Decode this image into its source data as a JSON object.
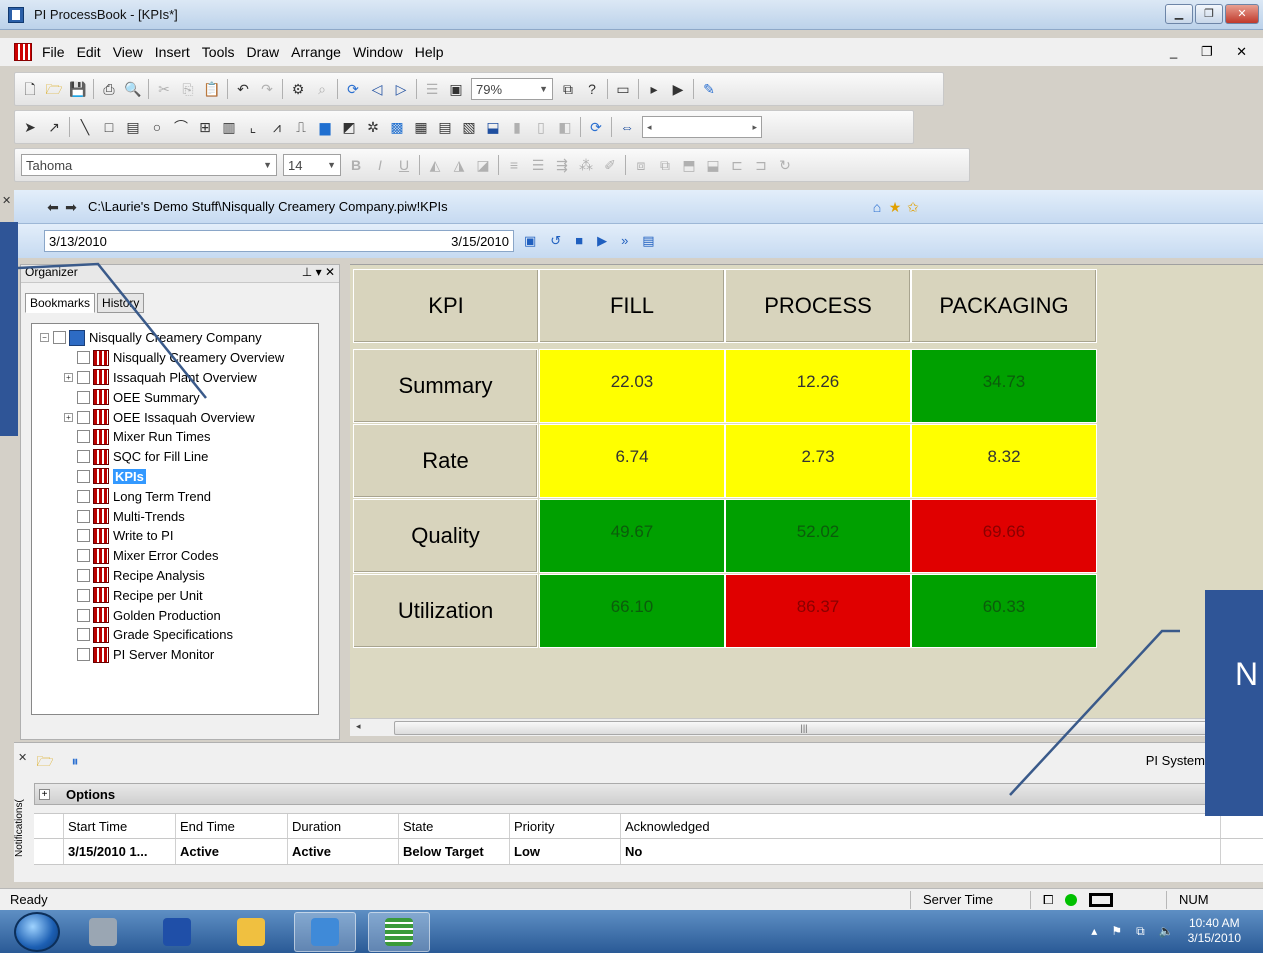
{
  "window": {
    "title": "PI ProcessBook - [KPIs*]",
    "buttons": [
      "▁",
      "❐",
      "✕"
    ]
  },
  "menu": {
    "items": [
      "File",
      "Edit",
      "View",
      "Insert",
      "Tools",
      "Draw",
      "Arrange",
      "Window",
      "Help"
    ],
    "right_controls": "_ ❐ ✕"
  },
  "toolbar": {
    "zoom_value": "79%",
    "font_name": "Tahoma",
    "font_size": "14"
  },
  "navigation": {
    "path": "C:\\Laurie's Demo Stuff\\Nisqually Creamery Company.piw!KPIs",
    "start_time": "3/13/2010",
    "end_time": "3/15/2010"
  },
  "organizer": {
    "title": "Organizer",
    "tabs": [
      "Bookmarks",
      "History"
    ],
    "root": "Nisqually Creamery Company",
    "items": [
      {
        "label": "Nisqually Creamery Overview",
        "expandable": false,
        "selected": false
      },
      {
        "label": "Issaquah Plant Overview",
        "expandable": true,
        "selected": false
      },
      {
        "label": "OEE Summary",
        "expandable": false,
        "selected": false
      },
      {
        "label": "OEE Issaquah Overview",
        "expandable": true,
        "selected": false
      },
      {
        "label": "Mixer Run Times",
        "expandable": false,
        "selected": false
      },
      {
        "label": "SQC for Fill Line",
        "expandable": false,
        "selected": false
      },
      {
        "label": "KPIs",
        "expandable": false,
        "selected": true
      },
      {
        "label": "Long Term Trend",
        "expandable": false,
        "selected": false
      },
      {
        "label": "Multi-Trends",
        "expandable": false,
        "selected": false
      },
      {
        "label": "Write to PI",
        "expandable": false,
        "selected": false
      },
      {
        "label": "Mixer Error Codes",
        "expandable": false,
        "selected": false
      },
      {
        "label": "Recipe Analysis",
        "expandable": false,
        "selected": false
      },
      {
        "label": "Recipe per Unit",
        "expandable": false,
        "selected": false
      },
      {
        "label": "Golden Production",
        "expandable": false,
        "selected": false
      },
      {
        "label": "Grade Specifications",
        "expandable": false,
        "selected": false
      },
      {
        "label": "PI Server Monitor",
        "expandable": false,
        "selected": false
      }
    ]
  },
  "kpi_table": {
    "headers": [
      "KPI",
      "FILL",
      "PROCESS",
      "PACKAGING"
    ],
    "rows": [
      {
        "label": "Summary",
        "values": [
          "22.03",
          "12.26",
          "34.73"
        ],
        "colors": [
          "yellow",
          "yellow",
          "green"
        ]
      },
      {
        "label": "Rate",
        "values": [
          "6.74",
          "2.73",
          "8.32"
        ],
        "colors": [
          "yellow",
          "yellow",
          "yellow"
        ]
      },
      {
        "label": "Quality",
        "values": [
          "49.67",
          "52.02",
          "69.66"
        ],
        "colors": [
          "green",
          "green",
          "red"
        ]
      },
      {
        "label": "Utilization",
        "values": [
          "66.10",
          "86.37",
          "60.33"
        ],
        "colors": [
          "green",
          "red",
          "green"
        ]
      }
    ],
    "status_colors": {
      "yellow": "#ffff00",
      "green": "#00a000",
      "red": "#e00000"
    }
  },
  "notifications": {
    "panel_label": "Notifications(",
    "source": "PI System",
    "options_label": "Options",
    "columns": [
      "Start Time",
      "End Time",
      "Duration",
      "State",
      "Priority",
      "Acknowledged"
    ],
    "rows": [
      [
        "3/15/2010 1...",
        "Active",
        "Active",
        "Below Target",
        "Low",
        "No"
      ]
    ]
  },
  "status": {
    "ready": "Ready",
    "server_time": "Server Time",
    "num": "NUM"
  },
  "taskbar": {
    "time": "10:40 AM",
    "date": "3/15/2010"
  },
  "callouts": {
    "right_letter": "N"
  }
}
